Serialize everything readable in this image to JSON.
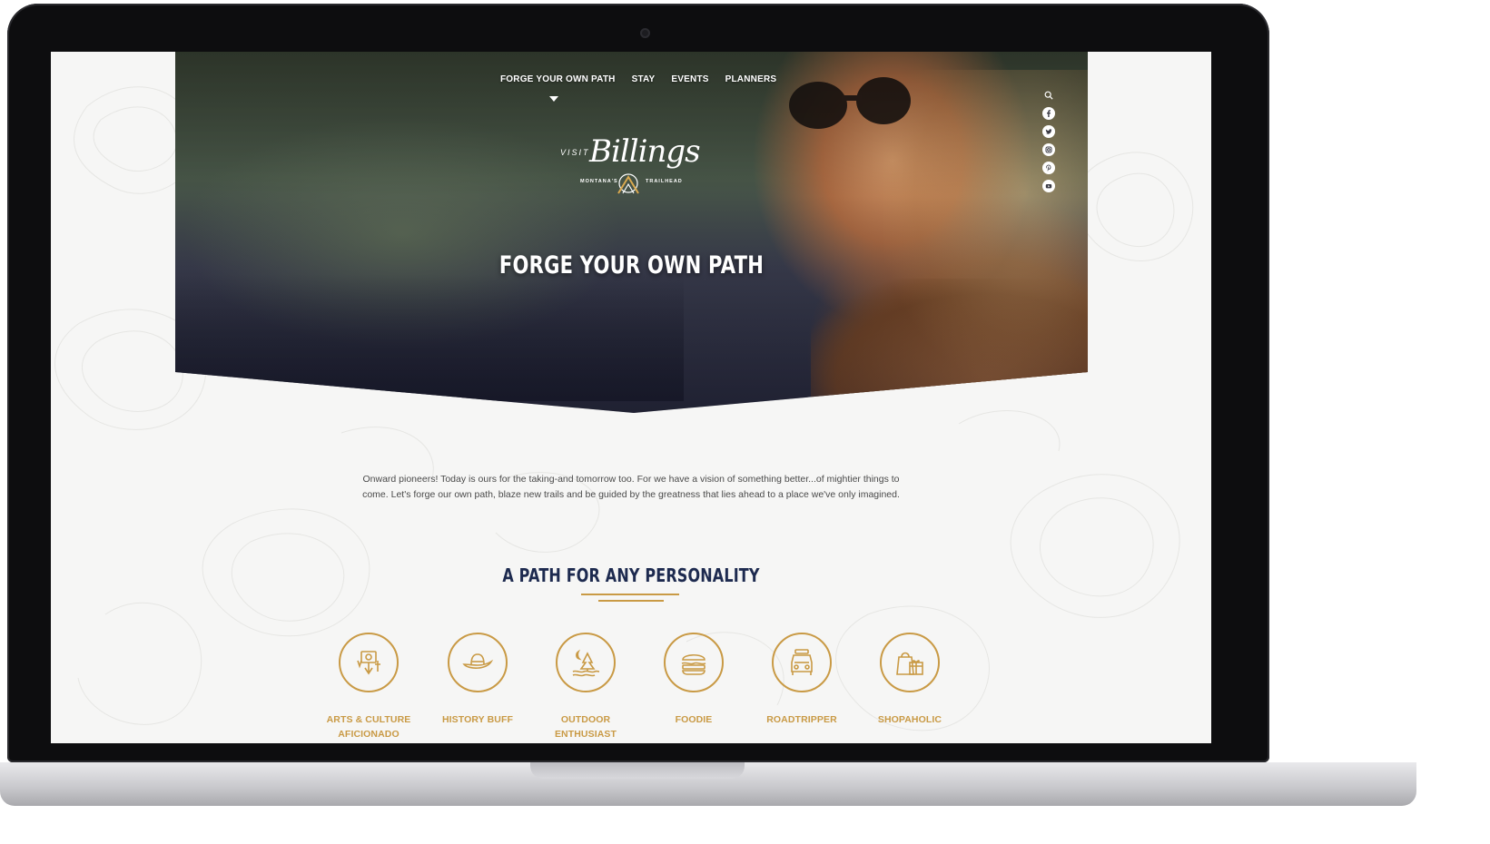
{
  "nav": {
    "items": [
      {
        "label": "FORGE YOUR OWN PATH"
      },
      {
        "label": "STAY"
      },
      {
        "label": "EVENTS"
      },
      {
        "label": "PLANNERS"
      }
    ]
  },
  "logo": {
    "visit": "VISIT",
    "name": "Billings",
    "tag_left": "MONTANA'S",
    "tag_right": "TRAILHEAD"
  },
  "hero": {
    "title": "FORGE YOUR OWN PATH"
  },
  "social": [
    "search-icon",
    "facebook-icon",
    "twitter-icon",
    "instagram-icon",
    "pinterest-icon",
    "youtube-icon"
  ],
  "intro": "Onward pioneers! Today is ours for the taking-and tomorrow too.  For we have a vision of something better...of mightier things to come.  Let's forge our own path, blaze new trails and be guided by the greatness that lies ahead to a place we've only imagined.",
  "section": {
    "title": "A PATH FOR ANY PERSONALITY"
  },
  "personas": [
    {
      "line1": "ARTS & CULTURE",
      "line2": "AFICIONADO",
      "icon": "arts-icon"
    },
    {
      "line1": "HISTORY BUFF",
      "line2": "",
      "icon": "hat-icon"
    },
    {
      "line1": "OUTDOOR",
      "line2": "ENTHUSIAST",
      "icon": "outdoor-icon"
    },
    {
      "line1": "FOODIE",
      "line2": "",
      "icon": "burger-icon"
    },
    {
      "line1": "ROADTRIPPER",
      "line2": "",
      "icon": "car-icon"
    },
    {
      "line1": "SHOPAHOLIC",
      "line2": "",
      "icon": "shopping-icon"
    }
  ],
  "colors": {
    "accent": "#c99a45",
    "heading": "#1d2a4f",
    "body_text": "#4a4a4a"
  }
}
